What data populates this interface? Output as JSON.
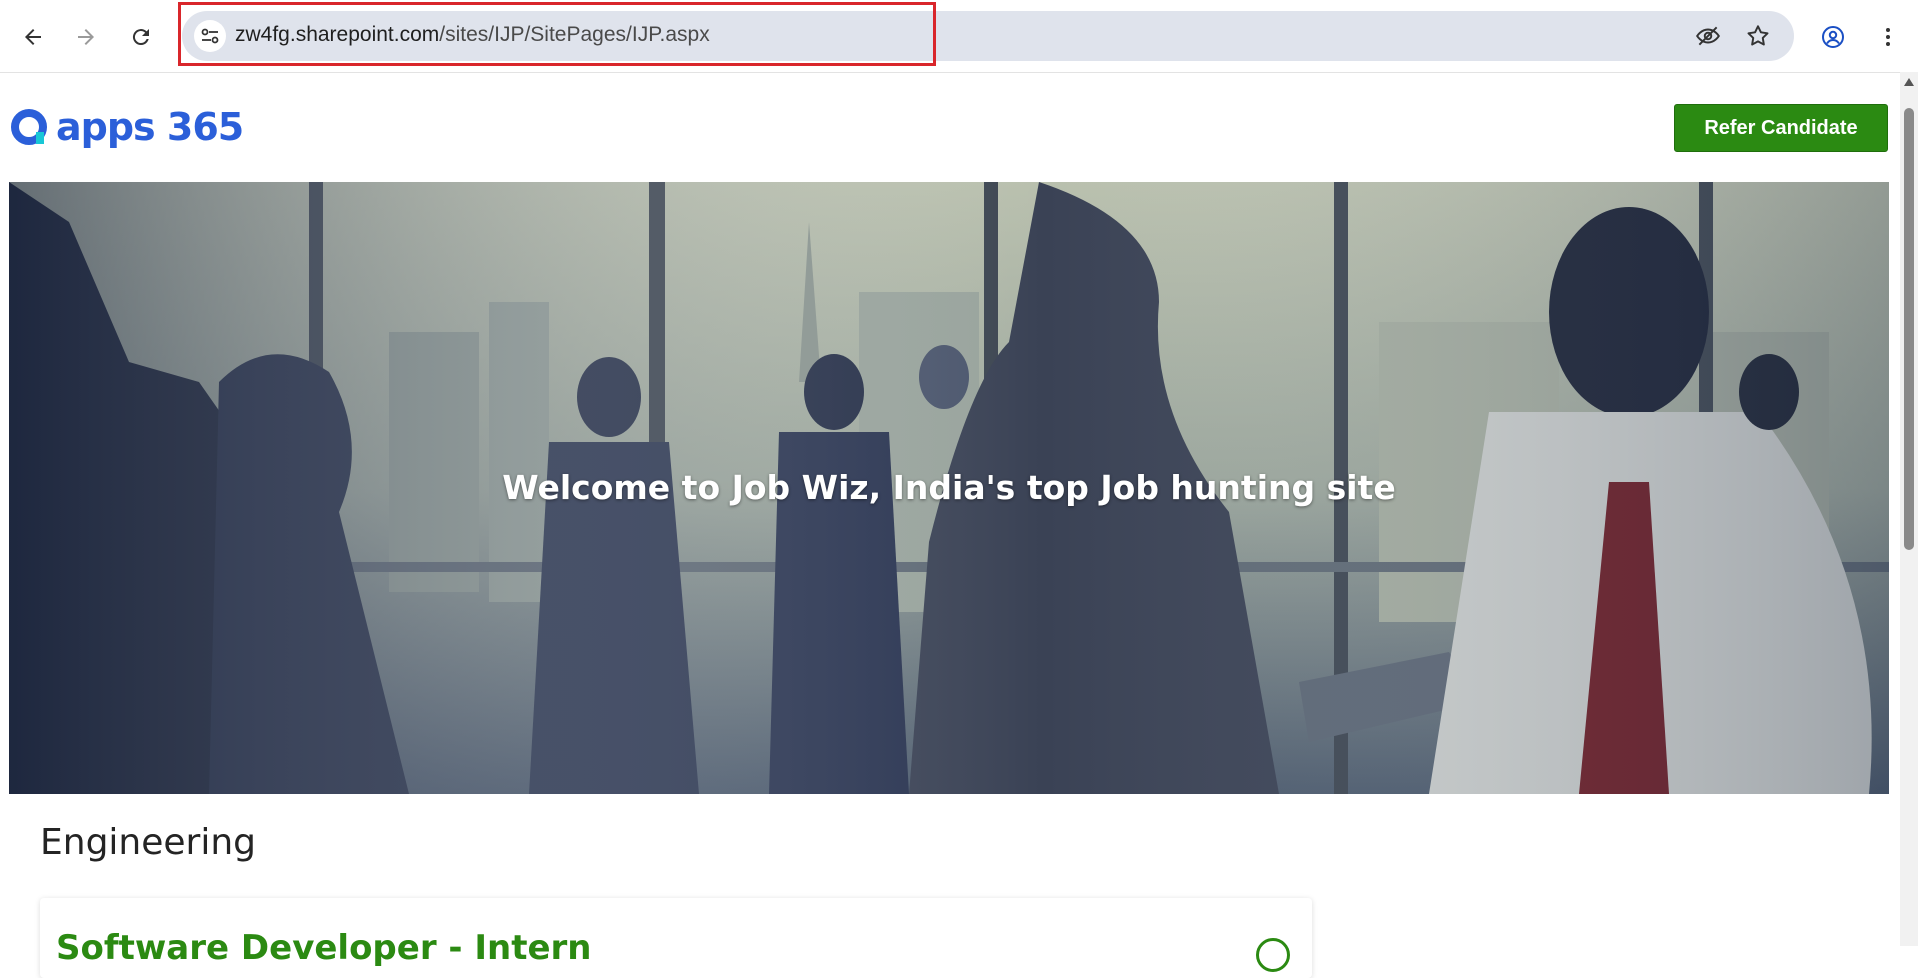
{
  "browser": {
    "url_host": "zw4fg.sharepoint.com",
    "url_path": "/sites/IJP/SitePages/IJP.aspx",
    "icons": [
      "back-arrow-icon",
      "forward-arrow-icon",
      "reload-icon",
      "site-info-icon",
      "eye-off-icon",
      "star-icon",
      "profile-icon",
      "more-vert-icon"
    ],
    "highlight_color": "#d9262b"
  },
  "page": {
    "logo_text": "apps 365",
    "refer_button": "Refer Candidate",
    "hero_title": "Welcome to Job Wiz, India's top Job hunting site",
    "section_title": "Engineering",
    "card_title": "Software Developer - Intern",
    "accent_color": "#2b8a12",
    "brand_color": "#2b5fd9"
  }
}
